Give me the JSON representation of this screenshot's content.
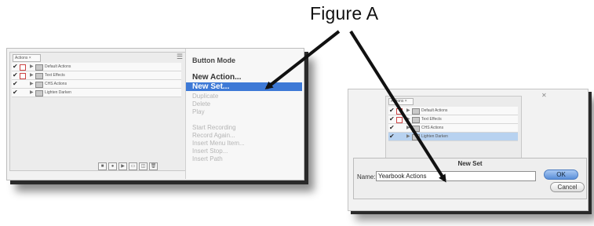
{
  "figure": {
    "title": "Figure A"
  },
  "left_panel": {
    "tab_label": "Actions ×",
    "rows": [
      {
        "label": "Default Actions"
      },
      {
        "label": "Text Effects"
      },
      {
        "label": "CHS Actions"
      },
      {
        "label": "Lighten Darken"
      }
    ],
    "bottom_icons": [
      "■",
      "●",
      "▶",
      "▭",
      "◫",
      "🗑"
    ],
    "menu": {
      "header": "Button Mode",
      "new_action": "New Action...",
      "new_set": "New Set...",
      "disabled_top": [
        "Duplicate",
        "Delete",
        "Play"
      ],
      "disabled_bottom": [
        "Start Recording",
        "Record Again...",
        "Insert Menu Item...",
        "Insert Stop...",
        "Insert Path"
      ]
    }
  },
  "right_panel": {
    "tab_label": "Actions ×",
    "rows": [
      {
        "label": "Default Actions"
      },
      {
        "label": "Text Effects"
      },
      {
        "label": "CHS Actions"
      },
      {
        "label": "Lighten Darken"
      }
    ],
    "dialog": {
      "title": "New Set",
      "name_label": "Name:",
      "name_value": "Yearbook Actions",
      "ok_label": "OK",
      "cancel_label": "Cancel"
    },
    "bottom_icons": [
      "■",
      "●",
      "▶",
      "▭",
      "◫",
      "🗑"
    ]
  },
  "colors": {
    "highlight": "#3d79d6",
    "row_highlight": "#b8d2f0",
    "ok_button": "#5a8fd9"
  }
}
